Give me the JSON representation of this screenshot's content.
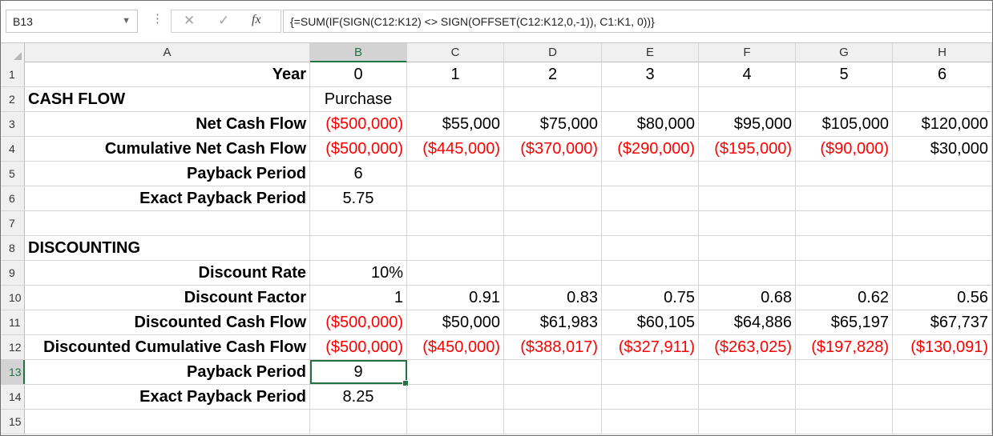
{
  "formula_bar": {
    "name_box": "B13",
    "formula": "{=SUM(IF(SIGN(C12:K12) <> SIGN(OFFSET(C12:K12,0,-1)), C1:K1, 0))}",
    "fx_label": "fx",
    "cancel_glyph": "✕",
    "enter_glyph": "✓",
    "more_glyph": "⋮",
    "dropdown_glyph": "▼"
  },
  "columns": [
    "A",
    "B",
    "C",
    "D",
    "E",
    "F",
    "G",
    "H"
  ],
  "rows": [
    {
      "n": "1",
      "cells": [
        {
          "v": "Year",
          "a": "r",
          "b": true
        },
        {
          "v": "0",
          "a": "c"
        },
        {
          "v": "1",
          "a": "c"
        },
        {
          "v": "2",
          "a": "c"
        },
        {
          "v": "3",
          "a": "c"
        },
        {
          "v": "4",
          "a": "c"
        },
        {
          "v": "5",
          "a": "c"
        },
        {
          "v": "6",
          "a": "c"
        }
      ]
    },
    {
      "n": "2",
      "cells": [
        {
          "v": "CASH FLOW",
          "a": "l",
          "b": true
        },
        {
          "v": "Purchase",
          "a": "c"
        },
        {
          "v": ""
        },
        {
          "v": ""
        },
        {
          "v": ""
        },
        {
          "v": ""
        },
        {
          "v": ""
        },
        {
          "v": ""
        }
      ]
    },
    {
      "n": "3",
      "cells": [
        {
          "v": "Net Cash Flow",
          "a": "r",
          "b": true
        },
        {
          "v": "($500,000)",
          "a": "r",
          "neg": true
        },
        {
          "v": "$55,000",
          "a": "r"
        },
        {
          "v": "$75,000",
          "a": "r"
        },
        {
          "v": "$80,000",
          "a": "r"
        },
        {
          "v": "$95,000",
          "a": "r"
        },
        {
          "v": "$105,000",
          "a": "r"
        },
        {
          "v": "$120,000",
          "a": "r"
        }
      ]
    },
    {
      "n": "4",
      "cells": [
        {
          "v": "Cumulative Net Cash Flow",
          "a": "r",
          "b": true
        },
        {
          "v": "($500,000)",
          "a": "r",
          "neg": true
        },
        {
          "v": "($445,000)",
          "a": "r",
          "neg": true
        },
        {
          "v": "($370,000)",
          "a": "r",
          "neg": true
        },
        {
          "v": "($290,000)",
          "a": "r",
          "neg": true
        },
        {
          "v": "($195,000)",
          "a": "r",
          "neg": true
        },
        {
          "v": "($90,000)",
          "a": "r",
          "neg": true
        },
        {
          "v": "$30,000",
          "a": "r"
        }
      ]
    },
    {
      "n": "5",
      "cells": [
        {
          "v": "Payback Period",
          "a": "r",
          "b": true
        },
        {
          "v": "6",
          "a": "c"
        },
        {
          "v": ""
        },
        {
          "v": ""
        },
        {
          "v": ""
        },
        {
          "v": ""
        },
        {
          "v": ""
        },
        {
          "v": ""
        }
      ]
    },
    {
      "n": "6",
      "cells": [
        {
          "v": "Exact Payback Period",
          "a": "r",
          "b": true
        },
        {
          "v": "5.75",
          "a": "c"
        },
        {
          "v": ""
        },
        {
          "v": ""
        },
        {
          "v": ""
        },
        {
          "v": ""
        },
        {
          "v": ""
        },
        {
          "v": ""
        }
      ]
    },
    {
      "n": "7",
      "cells": [
        {
          "v": ""
        },
        {
          "v": ""
        },
        {
          "v": ""
        },
        {
          "v": ""
        },
        {
          "v": ""
        },
        {
          "v": ""
        },
        {
          "v": ""
        },
        {
          "v": ""
        }
      ]
    },
    {
      "n": "8",
      "cells": [
        {
          "v": "DISCOUNTING",
          "a": "l",
          "b": true
        },
        {
          "v": ""
        },
        {
          "v": ""
        },
        {
          "v": ""
        },
        {
          "v": ""
        },
        {
          "v": ""
        },
        {
          "v": ""
        },
        {
          "v": ""
        }
      ]
    },
    {
      "n": "9",
      "cells": [
        {
          "v": "Discount Rate",
          "a": "r",
          "b": true
        },
        {
          "v": "10%",
          "a": "r"
        },
        {
          "v": ""
        },
        {
          "v": ""
        },
        {
          "v": ""
        },
        {
          "v": ""
        },
        {
          "v": ""
        },
        {
          "v": ""
        }
      ]
    },
    {
      "n": "10",
      "cells": [
        {
          "v": "Discount Factor",
          "a": "r",
          "b": true
        },
        {
          "v": "1",
          "a": "r"
        },
        {
          "v": "0.91",
          "a": "r"
        },
        {
          "v": "0.83",
          "a": "r"
        },
        {
          "v": "0.75",
          "a": "r"
        },
        {
          "v": "0.68",
          "a": "r"
        },
        {
          "v": "0.62",
          "a": "r"
        },
        {
          "v": "0.56",
          "a": "r"
        }
      ]
    },
    {
      "n": "11",
      "cells": [
        {
          "v": "Discounted Cash Flow",
          "a": "r",
          "b": true
        },
        {
          "v": "($500,000)",
          "a": "r",
          "neg": true
        },
        {
          "v": "$50,000",
          "a": "r"
        },
        {
          "v": "$61,983",
          "a": "r"
        },
        {
          "v": "$60,105",
          "a": "r"
        },
        {
          "v": "$64,886",
          "a": "r"
        },
        {
          "v": "$65,197",
          "a": "r"
        },
        {
          "v": "$67,737",
          "a": "r"
        }
      ]
    },
    {
      "n": "12",
      "cells": [
        {
          "v": "Discounted Cumulative Cash Flow",
          "a": "r",
          "b": true
        },
        {
          "v": "($500,000)",
          "a": "r",
          "neg": true
        },
        {
          "v": "($450,000)",
          "a": "r",
          "neg": true
        },
        {
          "v": "($388,017)",
          "a": "r",
          "neg": true
        },
        {
          "v": "($327,911)",
          "a": "r",
          "neg": true
        },
        {
          "v": "($263,025)",
          "a": "r",
          "neg": true
        },
        {
          "v": "($197,828)",
          "a": "r",
          "neg": true
        },
        {
          "v": "($130,091)",
          "a": "r",
          "neg": true
        }
      ]
    },
    {
      "n": "13",
      "cells": [
        {
          "v": "Payback Period",
          "a": "r",
          "b": true
        },
        {
          "v": "9",
          "a": "c",
          "active": true
        },
        {
          "v": ""
        },
        {
          "v": ""
        },
        {
          "v": ""
        },
        {
          "v": ""
        },
        {
          "v": ""
        },
        {
          "v": ""
        }
      ]
    },
    {
      "n": "14",
      "cells": [
        {
          "v": "Exact Payback Period",
          "a": "r",
          "b": true
        },
        {
          "v": "8.25",
          "a": "c"
        },
        {
          "v": ""
        },
        {
          "v": ""
        },
        {
          "v": ""
        },
        {
          "v": ""
        },
        {
          "v": ""
        },
        {
          "v": ""
        }
      ]
    },
    {
      "n": "15",
      "cells": [
        {
          "v": ""
        },
        {
          "v": ""
        },
        {
          "v": ""
        },
        {
          "v": ""
        },
        {
          "v": ""
        },
        {
          "v": ""
        },
        {
          "v": ""
        },
        {
          "v": ""
        }
      ]
    }
  ],
  "selected": {
    "column": "B",
    "row": "13"
  },
  "colors": {
    "negative": "#ff0000",
    "accent": "#217346"
  }
}
